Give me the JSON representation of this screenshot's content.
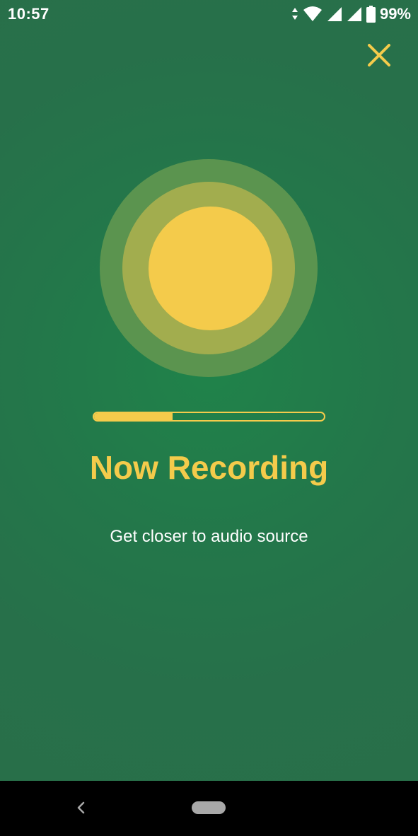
{
  "status_bar": {
    "time": "10:57",
    "battery_percent": "99%",
    "icons": [
      "data-arrows-icon",
      "wifi-icon",
      "signal-icon",
      "signal-icon",
      "battery-icon"
    ]
  },
  "header": {
    "close_icon": "close-icon"
  },
  "recorder": {
    "progress_fraction": 0.34,
    "title": "Now Recording",
    "subtitle": "Get closer to audio source"
  },
  "nav_bar": {
    "icons": [
      "back-icon",
      "home-pill-icon"
    ]
  },
  "colors": {
    "background": "#26744a",
    "accent": "#f4cb4b",
    "orb_outer": "#5b944f",
    "orb_middle": "#a2ad4e",
    "orb_inner": "#f4cb4b",
    "text": "#ffffff",
    "nav_bar": "#000000"
  }
}
